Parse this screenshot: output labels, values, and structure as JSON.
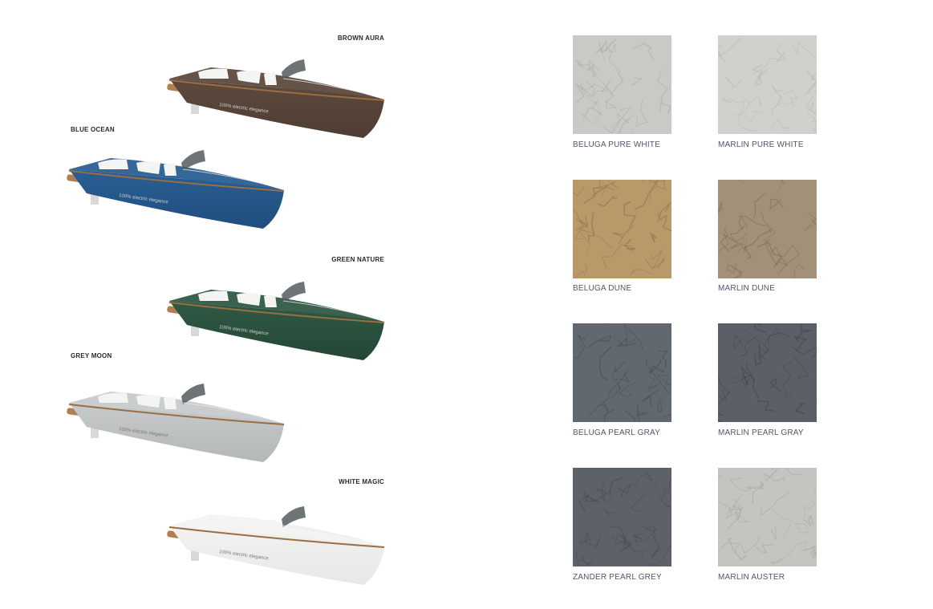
{
  "boats": [
    {
      "label": "BROWN AURA",
      "hull": "#4e3d33",
      "deck": "#5d4a3e"
    },
    {
      "label": "BLUE OCEAN",
      "hull": "#1f4d7d",
      "deck": "#2a5f94"
    },
    {
      "label": "GREEN NATURE",
      "hull": "#244636",
      "deck": "#2f5a45"
    },
    {
      "label": "GREY MOON",
      "hull": "#b4b7b8",
      "deck": "#c7cacb"
    },
    {
      "label": "WHITE MAGIC",
      "hull": "#e7e7e6",
      "deck": "#f2f2f1"
    }
  ],
  "hull_text": "100% electric elegance",
  "swatches": [
    {
      "label": "BELUGA PURE WHITE",
      "color": "#c9c9c5",
      "dark": "#a9a9a5"
    },
    {
      "label": "MARLIN PURE WHITE",
      "color": "#d0d0cc",
      "dark": "#b6b6b2"
    },
    {
      "label": "BELUGA DUNE",
      "color": "#b9996a",
      "dark": "#8e7046"
    },
    {
      "label": "MARLIN DUNE",
      "color": "#a39079",
      "dark": "#7f6c57"
    },
    {
      "label": "BELUGA PEARL GRAY",
      "color": "#626870",
      "dark": "#444a52"
    },
    {
      "label": "MARLIN PEARL GRAY",
      "color": "#5b6068",
      "dark": "#3f444b"
    },
    {
      "label": "ZANDER PEARL GREY",
      "color": "#5d6269",
      "dark": "#454a51"
    },
    {
      "label": "MARLIN AUSTER",
      "color": "#c4c5c0",
      "dark": "#a6a7a2"
    }
  ]
}
